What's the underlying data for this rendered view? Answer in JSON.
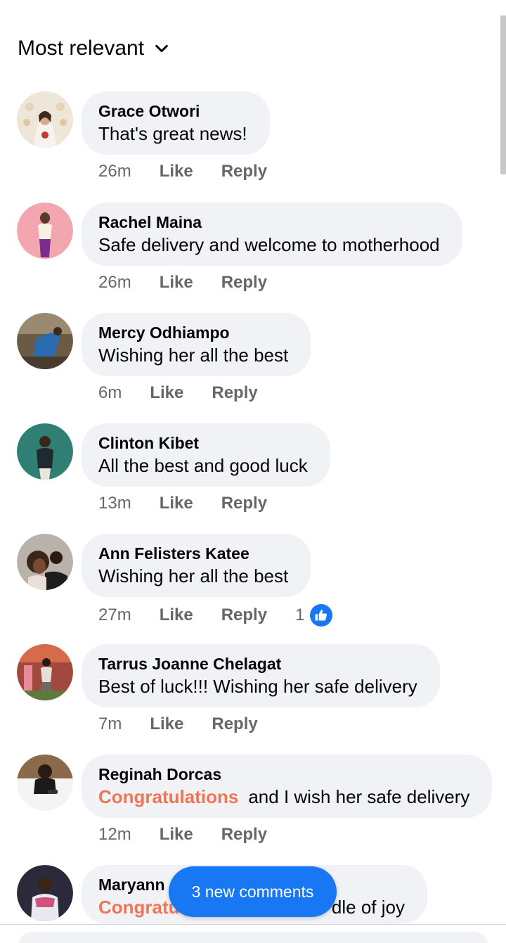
{
  "sort": {
    "label": "Most relevant"
  },
  "comments": [
    {
      "author": "Grace Otwori",
      "text": "That's great news!",
      "highlight": "",
      "time": "26m",
      "like": "Like",
      "reply": "Reply",
      "reactions": ""
    },
    {
      "author": "Rachel Maina",
      "text": "Safe delivery and welcome to motherhood",
      "highlight": "",
      "time": "26m",
      "like": "Like",
      "reply": "Reply",
      "reactions": ""
    },
    {
      "author": "Mercy Odhiampo",
      "text": "Wishing her all the best",
      "highlight": "",
      "time": "6m",
      "like": "Like",
      "reply": "Reply",
      "reactions": ""
    },
    {
      "author": "Clinton Kibet",
      "text": "All the best and good luck",
      "highlight": "",
      "time": "13m",
      "like": "Like",
      "reply": "Reply",
      "reactions": ""
    },
    {
      "author": "Ann Felisters Katee",
      "text": "Wishing her all the best",
      "highlight": "",
      "time": "27m",
      "like": "Like",
      "reply": "Reply",
      "reactions": "1"
    },
    {
      "author": "Tarrus Joanne Chelagat",
      "text": "Best of luck!!! Wishing her safe delivery",
      "highlight": "",
      "time": "7m",
      "like": "Like",
      "reply": "Reply",
      "reactions": ""
    },
    {
      "author": "Reginah Dorcas",
      "text": "and I wish her safe delivery",
      "highlight": "Congratulations",
      "time": "12m",
      "like": "Like",
      "reply": "Reply",
      "reactions": ""
    },
    {
      "author": "Maryann",
      "text": "dle of joy",
      "highlight": "Congratu",
      "time": "",
      "like": "",
      "reply": "",
      "reactions": ""
    }
  ],
  "toast": {
    "label": "3 new comments"
  },
  "colors": {
    "accent": "#1877f2",
    "bubble": "#f0f2f5",
    "highlight": "#f07556",
    "meta": "#65676b"
  },
  "icons": {
    "sort": "chevron-down-icon",
    "reaction": "thumbs-up-icon"
  }
}
